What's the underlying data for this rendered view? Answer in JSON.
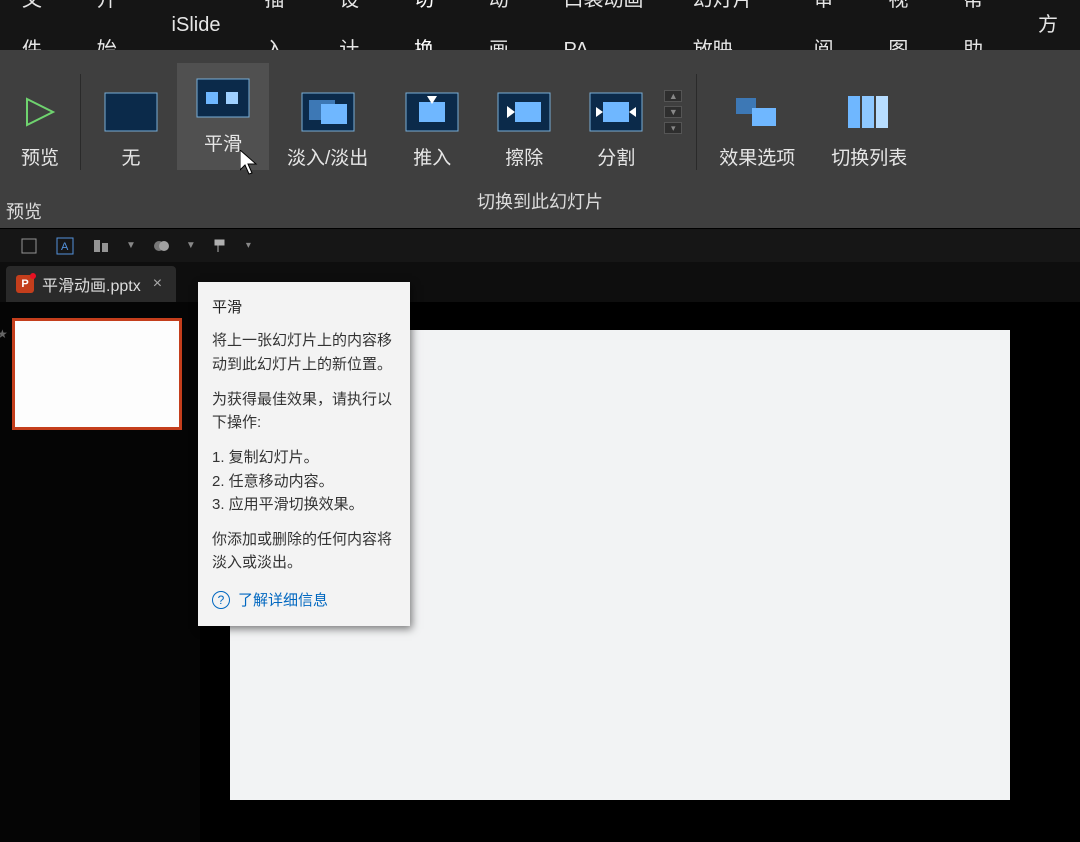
{
  "menubar": {
    "tabs": [
      "文件",
      "开始",
      "iSlide",
      "插入",
      "设计",
      "切换",
      "动画",
      "口袋动画 PA",
      "幻灯片放映",
      "审阅",
      "视图",
      "帮助"
    ],
    "active_index": 5,
    "overflow": "方"
  },
  "ribbon": {
    "preview_label": "预览",
    "transitions": [
      {
        "label": "无",
        "icon": "none"
      },
      {
        "label": "平滑",
        "icon": "morph"
      },
      {
        "label": "淡入/淡出",
        "icon": "fade"
      },
      {
        "label": "推入",
        "icon": "push"
      },
      {
        "label": "擦除",
        "icon": "wipe"
      },
      {
        "label": "分割",
        "icon": "split"
      }
    ],
    "effect_options": "效果选项",
    "transition_list": "切换列表",
    "group_caption": "切换到此幻灯片",
    "preview_side": "预览"
  },
  "qat": {
    "items": [
      "layout",
      "textbox",
      "align",
      "recolor",
      "formatpainter",
      "overflow"
    ]
  },
  "doctab": {
    "filename": "平滑动画.pptx"
  },
  "tooltip": {
    "title": "平滑",
    "p1": "将上一张幻灯片上的内容移动到此幻灯片上的新位置。",
    "p2": "为获得最佳效果，请执行以下操作:",
    "li1": "1. 复制幻灯片。",
    "li2": "2. 任意移动内容。",
    "li3": "3. 应用平滑切换效果。",
    "p3": "你添加或删除的任何内容将淡入或淡出。",
    "learn": "了解详细信息"
  }
}
